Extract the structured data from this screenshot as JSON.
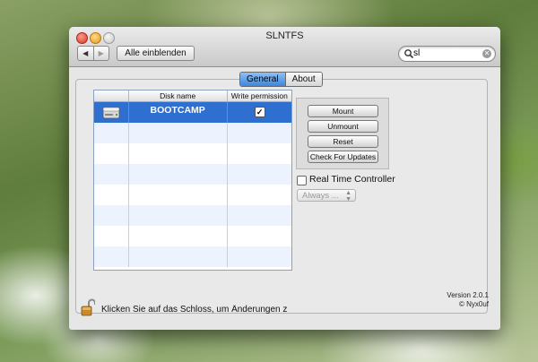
{
  "window": {
    "title": "SLNTFS",
    "nav_back": "◀",
    "nav_forward": "▶",
    "show_all": "Alle einblenden"
  },
  "search": {
    "value": "sl",
    "clear_glyph": "✕"
  },
  "tabs": [
    {
      "label": "General",
      "active": true
    },
    {
      "label": "About",
      "active": false
    }
  ],
  "table": {
    "columns": [
      "",
      "Disk name",
      "Write permission"
    ],
    "rows": [
      {
        "disk_name": "BOOTCAMP",
        "write_permission": true,
        "selected": true
      }
    ]
  },
  "buttons": {
    "mount": "Mount",
    "unmount": "Unmount",
    "reset": "Reset",
    "check_updates": "Check For Updates"
  },
  "real_time": {
    "label": "Real Time Controller",
    "checked": false,
    "popup_value": "Always ..."
  },
  "footer": {
    "lock_text": "Klicken Sie auf das Schloss, um Änderungen zu v",
    "version": "Version 2.0.1",
    "copyright": "© Nyx0uf"
  }
}
